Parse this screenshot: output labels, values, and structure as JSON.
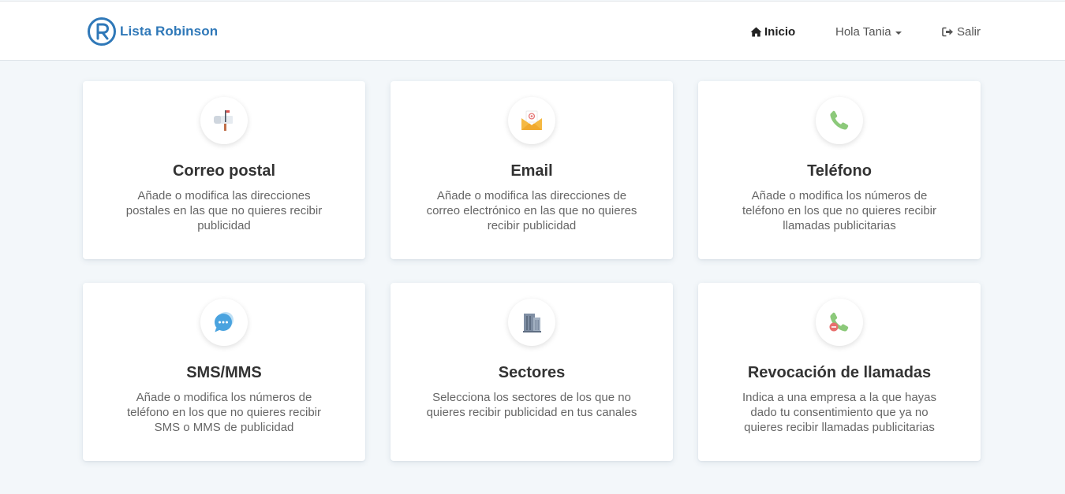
{
  "brand": {
    "name": "Lista Robinson",
    "color": "#2f78b8"
  },
  "nav": {
    "home_label": "Inicio",
    "user_label": "Hola Tania",
    "logout_label": "Salir"
  },
  "cards": [
    {
      "title": "Correo postal",
      "description": "Añade o modifica las direcciones postales en las que no quieres recibir publicidad",
      "icon": "mailbox-icon"
    },
    {
      "title": "Email",
      "description": "Añade o modifica las direcciones de correo electrónico en las que no quieres recibir publicidad",
      "icon": "email-envelope-icon"
    },
    {
      "title": "Teléfono",
      "description": "Añade o modifica los números de teléfono en los que no quieres recibir llamadas publicitarias",
      "icon": "phone-icon"
    },
    {
      "title": "SMS/MMS",
      "description": "Añade o modifica los números de teléfono en los que no quieres recibir SMS o MMS de publicidad",
      "icon": "chat-bubble-icon"
    },
    {
      "title": "Sectores",
      "description": "Selecciona los sectores de los que no quieres recibir publicidad en tus canales",
      "icon": "building-icon"
    },
    {
      "title": "Revocación de llamadas",
      "description": "Indica a una empresa a la que hayas dado tu consentimiento que ya no quieres recibir llamadas publicitarias",
      "icon": "phone-block-icon"
    }
  ]
}
